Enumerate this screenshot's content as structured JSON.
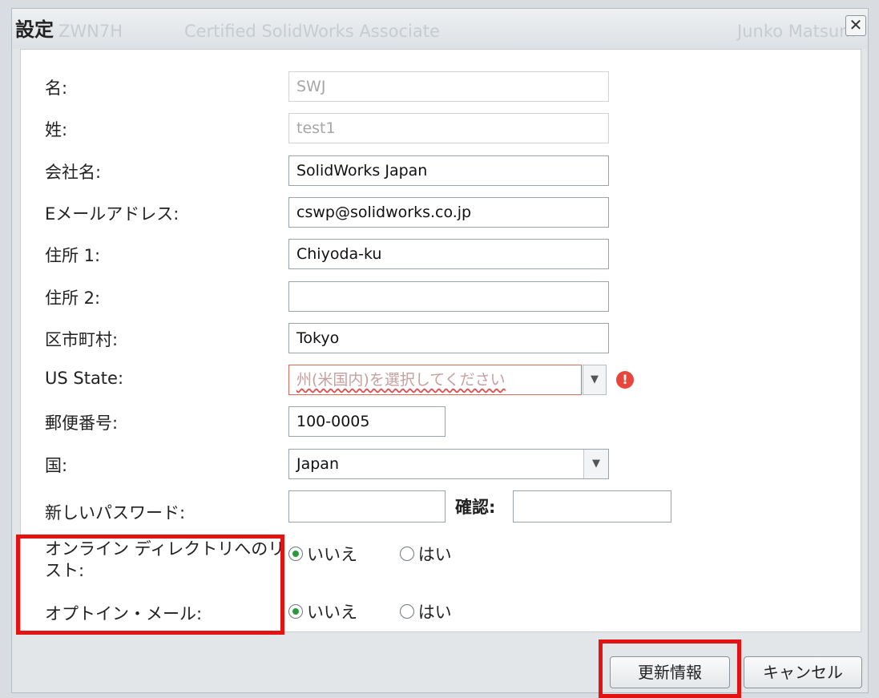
{
  "dialog": {
    "title": "設定",
    "background_text": [
      "ZWN7H",
      "Certified SolidWorks Associate",
      "Junko Matsum"
    ]
  },
  "form": {
    "first_name": {
      "label": "名:",
      "value": "SWJ"
    },
    "last_name": {
      "label": "姓:",
      "value": "test1"
    },
    "company": {
      "label": "会社名:",
      "value": "SolidWorks Japan"
    },
    "email": {
      "label": "Eメールアドレス:",
      "value": "cswp@solidworks.co.jp"
    },
    "address1": {
      "label": "住所 1:",
      "value": "Chiyoda-ku"
    },
    "address2": {
      "label": "住所 2:",
      "value": ""
    },
    "city": {
      "label": "区市町村:",
      "value": "Tokyo"
    },
    "us_state": {
      "label": "US State:",
      "placeholder": "州(米国内)を選択してください"
    },
    "postal": {
      "label": "郵便番号:",
      "value": "100-0005"
    },
    "country": {
      "label": "国:",
      "value": "Japan"
    },
    "new_password": {
      "label": "新しいパスワード:",
      "value": ""
    },
    "confirm": {
      "label": "確認:",
      "value": ""
    },
    "online_directory": {
      "label_line1": "オンライン ディレクトリへのリ",
      "label_line2": "スト:",
      "option_no": "いいえ",
      "option_yes": "はい",
      "selected": "いいえ"
    },
    "optin_mail": {
      "label": "オプトイン・メール:",
      "option_no": "いいえ",
      "option_yes": "はい",
      "selected": "いいえ"
    }
  },
  "buttons": {
    "update": "更新情報",
    "cancel": "キャンセル"
  },
  "icons": {
    "close": "close-icon",
    "dropdown": "chevron-down-icon",
    "error": "error-icon"
  },
  "colors": {
    "highlight": "#e41313",
    "radio_checked": "#2a9a3a",
    "error": "#e8453c"
  }
}
